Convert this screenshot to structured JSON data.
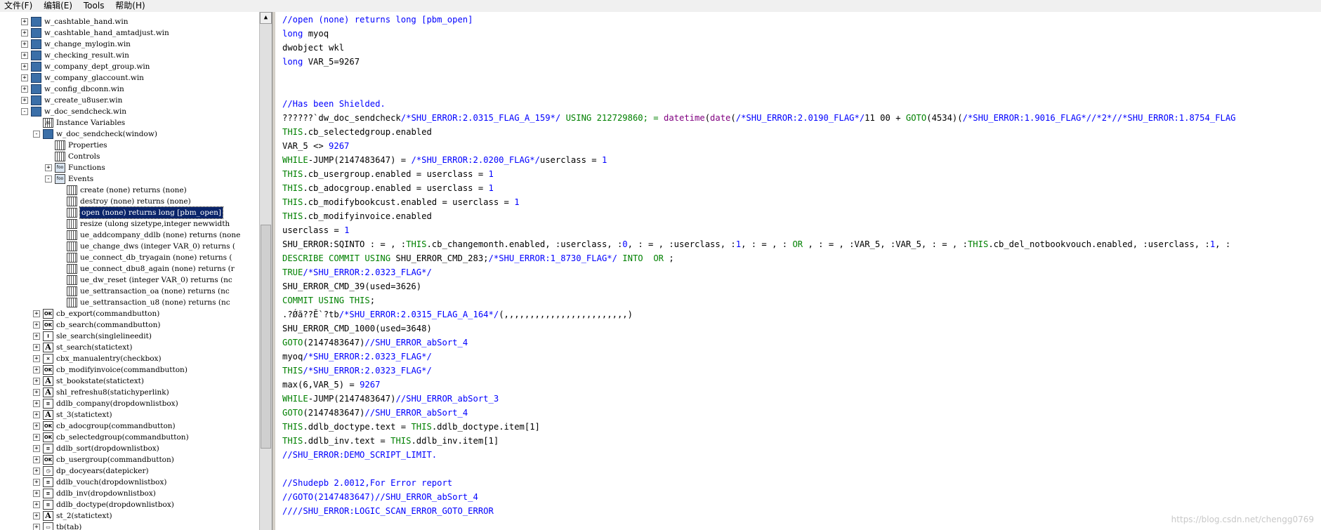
{
  "menubar": {
    "items": [
      "文件(F)",
      "编辑(E)",
      "Tools",
      "帮助(H)"
    ]
  },
  "tree": {
    "nodes": [
      {
        "indent": 0,
        "expander": "+",
        "icon": "window-icon",
        "label": "w_cashtable_hand.win"
      },
      {
        "indent": 0,
        "expander": "+",
        "icon": "window-icon",
        "label": "w_cashtable_hand_amtadjust.win"
      },
      {
        "indent": 0,
        "expander": "+",
        "icon": "window-icon",
        "label": "w_change_mylogin.win"
      },
      {
        "indent": 0,
        "expander": "+",
        "icon": "window-icon",
        "label": "w_checking_result.win"
      },
      {
        "indent": 0,
        "expander": "+",
        "icon": "window-icon",
        "label": "w_company_dept_group.win"
      },
      {
        "indent": 0,
        "expander": "+",
        "icon": "window-icon",
        "label": "w_company_glaccount.win"
      },
      {
        "indent": 0,
        "expander": "+",
        "icon": "window-icon",
        "label": "w_config_dbconn.win"
      },
      {
        "indent": 0,
        "expander": "+",
        "icon": "window-icon",
        "label": "w_create_u8user.win"
      },
      {
        "indent": 0,
        "expander": "-",
        "icon": "window-icon",
        "label": "w_doc_sendcheck.win"
      },
      {
        "indent": 1,
        "expander": "",
        "icon": "variables-icon",
        "label": "Instance Variables"
      },
      {
        "indent": 1,
        "expander": "-",
        "icon": "window-icon",
        "label": "w_doc_sendcheck(window)"
      },
      {
        "indent": 2,
        "expander": "",
        "icon": "grid-icon",
        "label": "Properties"
      },
      {
        "indent": 2,
        "expander": "",
        "icon": "grid-icon",
        "label": "Controls"
      },
      {
        "indent": 2,
        "expander": "+",
        "icon": "function-icon",
        "label": "Functions"
      },
      {
        "indent": 2,
        "expander": "-",
        "icon": "function-icon",
        "label": "Events"
      },
      {
        "indent": 3,
        "expander": "",
        "icon": "grid-icon",
        "label": "create (none) returns (none)"
      },
      {
        "indent": 3,
        "expander": "",
        "icon": "grid-icon",
        "label": "destroy (none) returns (none)"
      },
      {
        "indent": 3,
        "expander": "",
        "icon": "grid-icon",
        "label": "open (none) returns long [pbm_open]",
        "selected": true
      },
      {
        "indent": 3,
        "expander": "",
        "icon": "grid-icon",
        "label": "resize (ulong sizetype,integer newwidth"
      },
      {
        "indent": 3,
        "expander": "",
        "icon": "grid-icon",
        "label": "ue_addcompany_ddlb (none) returns (none"
      },
      {
        "indent": 3,
        "expander": "",
        "icon": "grid-icon",
        "label": "ue_change_dws (integer VAR_0) returns ("
      },
      {
        "indent": 3,
        "expander": "",
        "icon": "grid-icon",
        "label": "ue_connect_db_tryagain (none) returns ("
      },
      {
        "indent": 3,
        "expander": "",
        "icon": "grid-icon",
        "label": "ue_connect_dbu8_again (none) returns (r"
      },
      {
        "indent": 3,
        "expander": "",
        "icon": "grid-icon",
        "label": "ue_dw_reset (integer VAR_0) returns (nc"
      },
      {
        "indent": 3,
        "expander": "",
        "icon": "grid-icon",
        "label": "ue_settransaction_oa (none) returns (nc"
      },
      {
        "indent": 3,
        "expander": "",
        "icon": "grid-icon",
        "label": "ue_settransaction_u8 (none) returns (nc"
      },
      {
        "indent": 1,
        "expander": "+",
        "icon": "ok-icon",
        "label": "cb_export(commandbutton)"
      },
      {
        "indent": 1,
        "expander": "+",
        "icon": "ok-icon",
        "label": "cb_search(commandbutton)"
      },
      {
        "indent": 1,
        "expander": "+",
        "icon": "edit-icon",
        "label": "sle_search(singlelineedit)"
      },
      {
        "indent": 1,
        "expander": "+",
        "icon": "text-icon",
        "label": "st_search(statictext)"
      },
      {
        "indent": 1,
        "expander": "+",
        "icon": "checkbox-icon",
        "label": "cbx_manualentry(checkbox)"
      },
      {
        "indent": 1,
        "expander": "+",
        "icon": "ok-icon",
        "label": "cb_modifyinvoice(commandbutton)"
      },
      {
        "indent": 1,
        "expander": "+",
        "icon": "text-icon",
        "label": "st_bookstate(statictext)"
      },
      {
        "indent": 1,
        "expander": "+",
        "icon": "hyperlink-icon",
        "label": "shl_refreshu8(statichyperlink)"
      },
      {
        "indent": 1,
        "expander": "+",
        "icon": "dropdown-icon",
        "label": "ddlb_company(dropdownlistbox)"
      },
      {
        "indent": 1,
        "expander": "+",
        "icon": "text-icon",
        "label": "st_3(statictext)"
      },
      {
        "indent": 1,
        "expander": "+",
        "icon": "ok-icon",
        "label": "cb_adocgroup(commandbutton)"
      },
      {
        "indent": 1,
        "expander": "+",
        "icon": "ok-icon",
        "label": "cb_selectedgroup(commandbutton)"
      },
      {
        "indent": 1,
        "expander": "+",
        "icon": "dropdown-icon",
        "label": "ddlb_sort(dropdownlistbox)"
      },
      {
        "indent": 1,
        "expander": "+",
        "icon": "ok-icon",
        "label": "cb_usergroup(commandbutton)"
      },
      {
        "indent": 1,
        "expander": "+",
        "icon": "datepicker-icon",
        "label": "dp_docyears(datepicker)"
      },
      {
        "indent": 1,
        "expander": "+",
        "icon": "dropdown-icon",
        "label": "ddlb_vouch(dropdownlistbox)"
      },
      {
        "indent": 1,
        "expander": "+",
        "icon": "dropdown-icon",
        "label": "ddlb_inv(dropdownlistbox)"
      },
      {
        "indent": 1,
        "expander": "+",
        "icon": "dropdown-icon",
        "label": "ddlb_doctype(dropdownlistbox)"
      },
      {
        "indent": 1,
        "expander": "+",
        "icon": "text-icon",
        "label": "st_2(statictext)"
      },
      {
        "indent": 1,
        "expander": "+",
        "icon": "tab-icon",
        "label": "tb(tab)"
      }
    ]
  },
  "editor": {
    "lines": [
      [
        {
          "t": "//open (none) returns long [pbm_open]",
          "c": "cm"
        }
      ],
      [
        {
          "t": "long",
          "c": "cm"
        },
        {
          "t": " myoq",
          "c": ""
        }
      ],
      [
        {
          "t": "dwobject wkl",
          "c": ""
        }
      ],
      [
        {
          "t": "long",
          "c": "cm"
        },
        {
          "t": " VAR_5=9267",
          "c": ""
        }
      ],
      [],
      [],
      [
        {
          "t": "//Has been Shielded.",
          "c": "cm"
        }
      ],
      [
        {
          "t": "??????`dw_doc_sendcheck",
          "c": ""
        },
        {
          "t": "/*SHU_ERROR:2.0315_FLAG_A_159*/",
          "c": "cm"
        },
        {
          "t": " USING 212729860; = ",
          "c": "kw"
        },
        {
          "t": "datetime",
          "c": "fn"
        },
        {
          "t": "(",
          "c": ""
        },
        {
          "t": "date",
          "c": "fn"
        },
        {
          "t": "(",
          "c": ""
        },
        {
          "t": "/*SHU_ERROR:2.0190_FLAG*/",
          "c": "cm"
        },
        {
          "t": "11 00 + ",
          "c": ""
        },
        {
          "t": "GOTO",
          "c": "kw"
        },
        {
          "t": "(4534)(",
          "c": ""
        },
        {
          "t": "/*SHU_ERROR:1.9016_FLAG*//*2*//*SHU_ERROR:1.8754_FLAG",
          "c": "cm"
        }
      ],
      [
        {
          "t": "THIS",
          "c": "kw"
        },
        {
          "t": ".cb_selectedgroup.enabled",
          "c": ""
        }
      ],
      [
        {
          "t": "VAR_5 <> ",
          "c": ""
        },
        {
          "t": "9267",
          "c": "nm"
        }
      ],
      [
        {
          "t": "WHILE",
          "c": "kw"
        },
        {
          "t": "-JUMP(2147483647) = ",
          "c": ""
        },
        {
          "t": "/*SHU_ERROR:2.0200_FLAG*/",
          "c": "cm"
        },
        {
          "t": "userclass = ",
          "c": ""
        },
        {
          "t": "1",
          "c": "nm"
        }
      ],
      [
        {
          "t": "THIS",
          "c": "kw"
        },
        {
          "t": ".cb_usergroup.enabled = userclass = ",
          "c": ""
        },
        {
          "t": "1",
          "c": "nm"
        }
      ],
      [
        {
          "t": "THIS",
          "c": "kw"
        },
        {
          "t": ".cb_adocgroup.enabled = userclass = ",
          "c": ""
        },
        {
          "t": "1",
          "c": "nm"
        }
      ],
      [
        {
          "t": "THIS",
          "c": "kw"
        },
        {
          "t": ".cb_modifybookcust.enabled = userclass = ",
          "c": ""
        },
        {
          "t": "1",
          "c": "nm"
        }
      ],
      [
        {
          "t": "THIS",
          "c": "kw"
        },
        {
          "t": ".cb_modifyinvoice.enabled",
          "c": ""
        }
      ],
      [
        {
          "t": "userclass = ",
          "c": ""
        },
        {
          "t": "1",
          "c": "nm"
        }
      ],
      [
        {
          "t": "SHU_ERROR:SQINTO : = , :",
          "c": ""
        },
        {
          "t": "THIS",
          "c": "kw"
        },
        {
          "t": ".cb_changemonth.enabled, :userclass, :",
          "c": ""
        },
        {
          "t": "0",
          "c": "nm"
        },
        {
          "t": ", : = , :userclass, :",
          "c": ""
        },
        {
          "t": "1",
          "c": "nm"
        },
        {
          "t": ", : = , : ",
          "c": ""
        },
        {
          "t": "OR",
          "c": "kw"
        },
        {
          "t": " , : = , :VAR_5, :VAR_5, : = , :",
          "c": ""
        },
        {
          "t": "THIS",
          "c": "kw"
        },
        {
          "t": ".cb_del_notbookvouch.enabled, :userclass, :",
          "c": ""
        },
        {
          "t": "1",
          "c": "nm"
        },
        {
          "t": ", :",
          "c": ""
        }
      ],
      [
        {
          "t": "DESCRIBE COMMIT USING",
          "c": "kw"
        },
        {
          "t": " SHU_ERROR_CMD_283;",
          "c": ""
        },
        {
          "t": "/*SHU_ERROR:1_8730_FLAG*/",
          "c": "cm"
        },
        {
          "t": " INTO  OR",
          "c": "kw"
        },
        {
          "t": " ;",
          "c": ""
        }
      ],
      [
        {
          "t": "TRUE",
          "c": "kw"
        },
        {
          "t": "/*SHU_ERROR:2.0323_FLAG*/",
          "c": "cm"
        }
      ],
      [
        {
          "t": "SHU_ERROR_CMD_39(used=3626)",
          "c": ""
        }
      ],
      [
        {
          "t": "COMMIT USING THIS",
          "c": "kw"
        },
        {
          "t": ";",
          "c": ""
        }
      ],
      [
        {
          "t": ".?Ǿã??Ĕ`?tb",
          "c": ""
        },
        {
          "t": "/*SHU_ERROR:2.0315_FLAG_A_164*/",
          "c": "cm"
        },
        {
          "t": "(,,,,,,,,,,,,,,,,,,,,,,,,)",
          "c": ""
        }
      ],
      [
        {
          "t": "SHU_ERROR_CMD_1000(used=3648)",
          "c": ""
        }
      ],
      [
        {
          "t": "GOTO",
          "c": "kw"
        },
        {
          "t": "(2147483647)",
          "c": ""
        },
        {
          "t": "//SHU_ERROR_abSort_4",
          "c": "cm"
        }
      ],
      [
        {
          "t": "myoq",
          "c": ""
        },
        {
          "t": "/*SHU_ERROR:2.0323_FLAG*/",
          "c": "cm"
        }
      ],
      [
        {
          "t": "THIS",
          "c": "kw"
        },
        {
          "t": "/*SHU_ERROR:2.0323_FLAG*/",
          "c": "cm"
        }
      ],
      [
        {
          "t": "max(6,VAR_5) = ",
          "c": ""
        },
        {
          "t": "9267",
          "c": "nm"
        }
      ],
      [
        {
          "t": "WHILE",
          "c": "kw"
        },
        {
          "t": "-JUMP(2147483647)",
          "c": ""
        },
        {
          "t": "//SHU_ERROR_abSort_3",
          "c": "cm"
        }
      ],
      [
        {
          "t": "GOTO",
          "c": "kw"
        },
        {
          "t": "(2147483647)",
          "c": ""
        },
        {
          "t": "//SHU_ERROR_abSort_4",
          "c": "cm"
        }
      ],
      [
        {
          "t": "THIS",
          "c": "kw"
        },
        {
          "t": ".ddlb_doctype.text = ",
          "c": ""
        },
        {
          "t": "THIS",
          "c": "kw"
        },
        {
          "t": ".ddlb_doctype.item[1]",
          "c": ""
        }
      ],
      [
        {
          "t": "THIS",
          "c": "kw"
        },
        {
          "t": ".ddlb_inv.text = ",
          "c": ""
        },
        {
          "t": "THIS",
          "c": "kw"
        },
        {
          "t": ".ddlb_inv.item[1]",
          "c": ""
        }
      ],
      [
        {
          "t": "//SHU_ERROR:DEMO_SCRIPT_LIMIT.",
          "c": "cm"
        }
      ],
      [],
      [
        {
          "t": "//Shudepb 2.0012,For Error report",
          "c": "cm"
        }
      ],
      [
        {
          "t": "//GOTO(2147483647)//SHU_ERROR_abSort_4",
          "c": "cm"
        }
      ],
      [
        {
          "t": "////SHU_ERROR:LOGIC_SCAN_ERROR_GOTO_ERROR",
          "c": "cm"
        }
      ]
    ]
  },
  "watermark": "https://blog.csdn.net/chengg0769"
}
